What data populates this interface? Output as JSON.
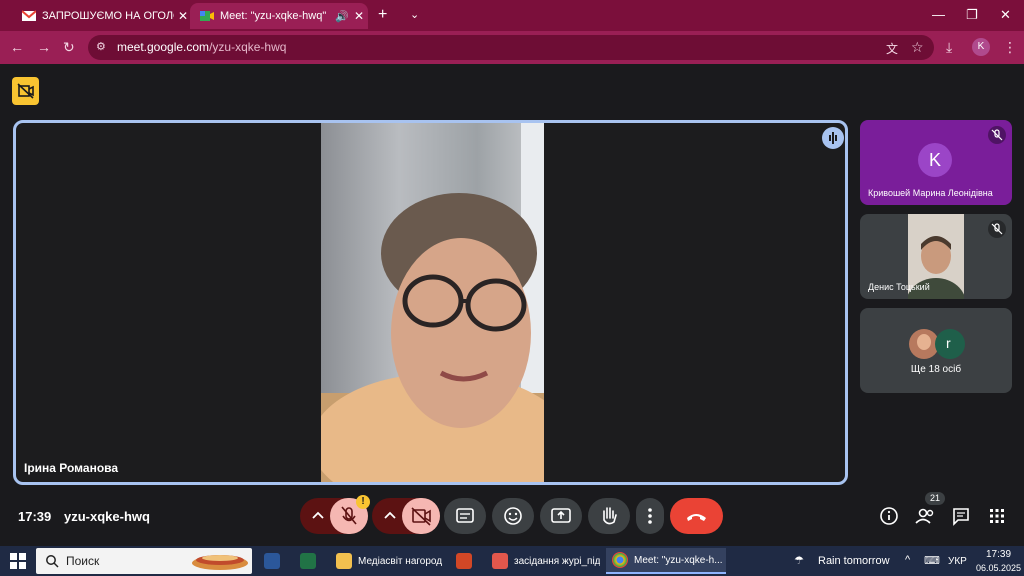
{
  "browser": {
    "tabs": [
      {
        "title": "ЗАПРОШУЄМО НА ОГОЛОШЕ",
        "favicon": "gmail-icon"
      },
      {
        "title": "Meet: \"yzu-xqke-hwq\"",
        "favicon": "meet-icon"
      }
    ],
    "url_host": "meet.google.com",
    "url_path": "/yzu-xqke-hwq",
    "profile_initial": "K",
    "colors": {
      "tabbar": "#7b0f3b",
      "toolbar": "#9a1f55"
    }
  },
  "meet": {
    "main_participant": "Ірина Романова",
    "participants": [
      {
        "name": "Кривошей Марина Леонідівна",
        "initial": "K",
        "color": "#9b45c7"
      },
      {
        "name": "Денис Тоцький"
      }
    ],
    "more_tile": {
      "label": "Ще 18 осіб",
      "avatar_initial": "r"
    },
    "clock": "17:39",
    "meeting_code": "yzu-xqke-hwq",
    "people_count": "21",
    "warning_mark": "!",
    "colors": {
      "active_border": "#a8c3f0",
      "end_call": "#ea4335",
      "muted": "#f5b7b2"
    }
  },
  "taskbar": {
    "search_placeholder": "Поиск",
    "items": [
      {
        "label": "",
        "icon": "word-icon"
      },
      {
        "label": "",
        "icon": "excel-icon"
      },
      {
        "label": "Медіасвіт нагород...",
        "icon": "folder-icon"
      },
      {
        "label": "",
        "icon": "powerpoint-icon"
      },
      {
        "label": "засідання журі_під...",
        "icon": "pdf-icon"
      },
      {
        "label": "Meet: \"yzu-xqke-h...",
        "icon": "chrome-icon"
      }
    ],
    "weather": "Rain tomorrow",
    "language": "УКР",
    "time": "17:39",
    "date": "06.05.2025"
  }
}
